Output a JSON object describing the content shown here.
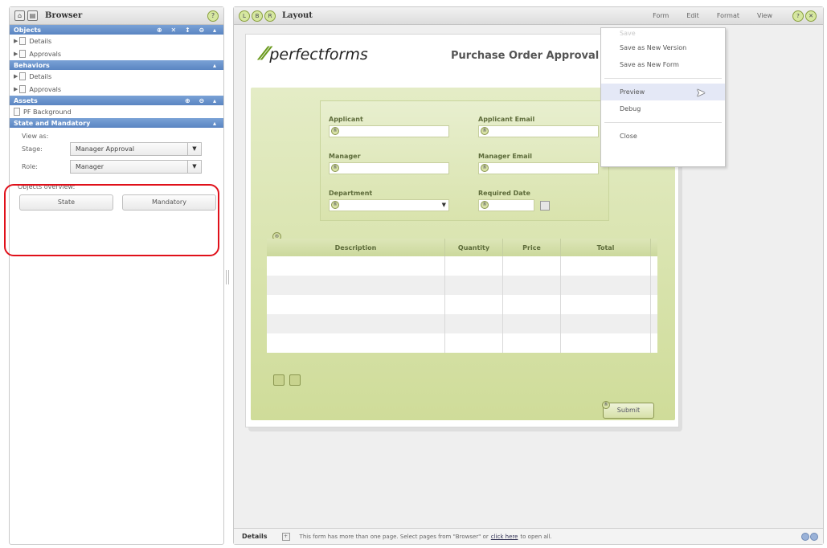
{
  "browser": {
    "title": "Browser",
    "sections": {
      "objects": {
        "title": "Objects",
        "tools": "⊕ ✕ ↕ ⊖ ▴",
        "items": [
          "Details",
          "Approvals"
        ]
      },
      "behaviors": {
        "title": "Behaviors",
        "tools": "▴",
        "items": [
          "Details",
          "Approvals"
        ]
      },
      "assets": {
        "title": "Assets",
        "tools": "⊕ ⊖ ▴",
        "items": [
          "PF Background"
        ]
      },
      "state": {
        "title": "State and Mandatory",
        "tools": "▴"
      }
    },
    "view_as": {
      "label": "View as:",
      "stage_label": "Stage:",
      "stage_value": "Manager Approval",
      "role_label": "Role:",
      "role_value": "Manager"
    },
    "objects_overview": {
      "label": "Objects overview:",
      "state_btn": "State",
      "mandatory_btn": "Mandatory"
    }
  },
  "layout": {
    "title": "Layout",
    "header_circles": [
      "L",
      "B",
      "R"
    ],
    "menus": [
      "Form",
      "Edit",
      "Format",
      "View"
    ],
    "form_menu": {
      "items": [
        "Save",
        "Save as New Version",
        "Save as New Form",
        "Preview",
        "Debug",
        "Close"
      ]
    }
  },
  "form": {
    "logo": "perfectforms",
    "title": "Purchase Order Approval",
    "fields": {
      "applicant": "Applicant",
      "applicant_email": "Applicant Email",
      "manager": "Manager",
      "manager_email": "Manager Email",
      "department": "Department",
      "required_date": "Required Date"
    },
    "table": {
      "columns": [
        "Description",
        "Quantity",
        "Price",
        "Total"
      ]
    },
    "submit": "Submit"
  },
  "status": {
    "tab": "Details",
    "message": "This form has more than one page. Select pages from \"Browser\" or",
    "link": "click here",
    "message_end": "to open all."
  },
  "colors": {
    "section_bar": "#5a85c2",
    "form_green": "#cfdc99",
    "highlight": "#e0101a"
  }
}
